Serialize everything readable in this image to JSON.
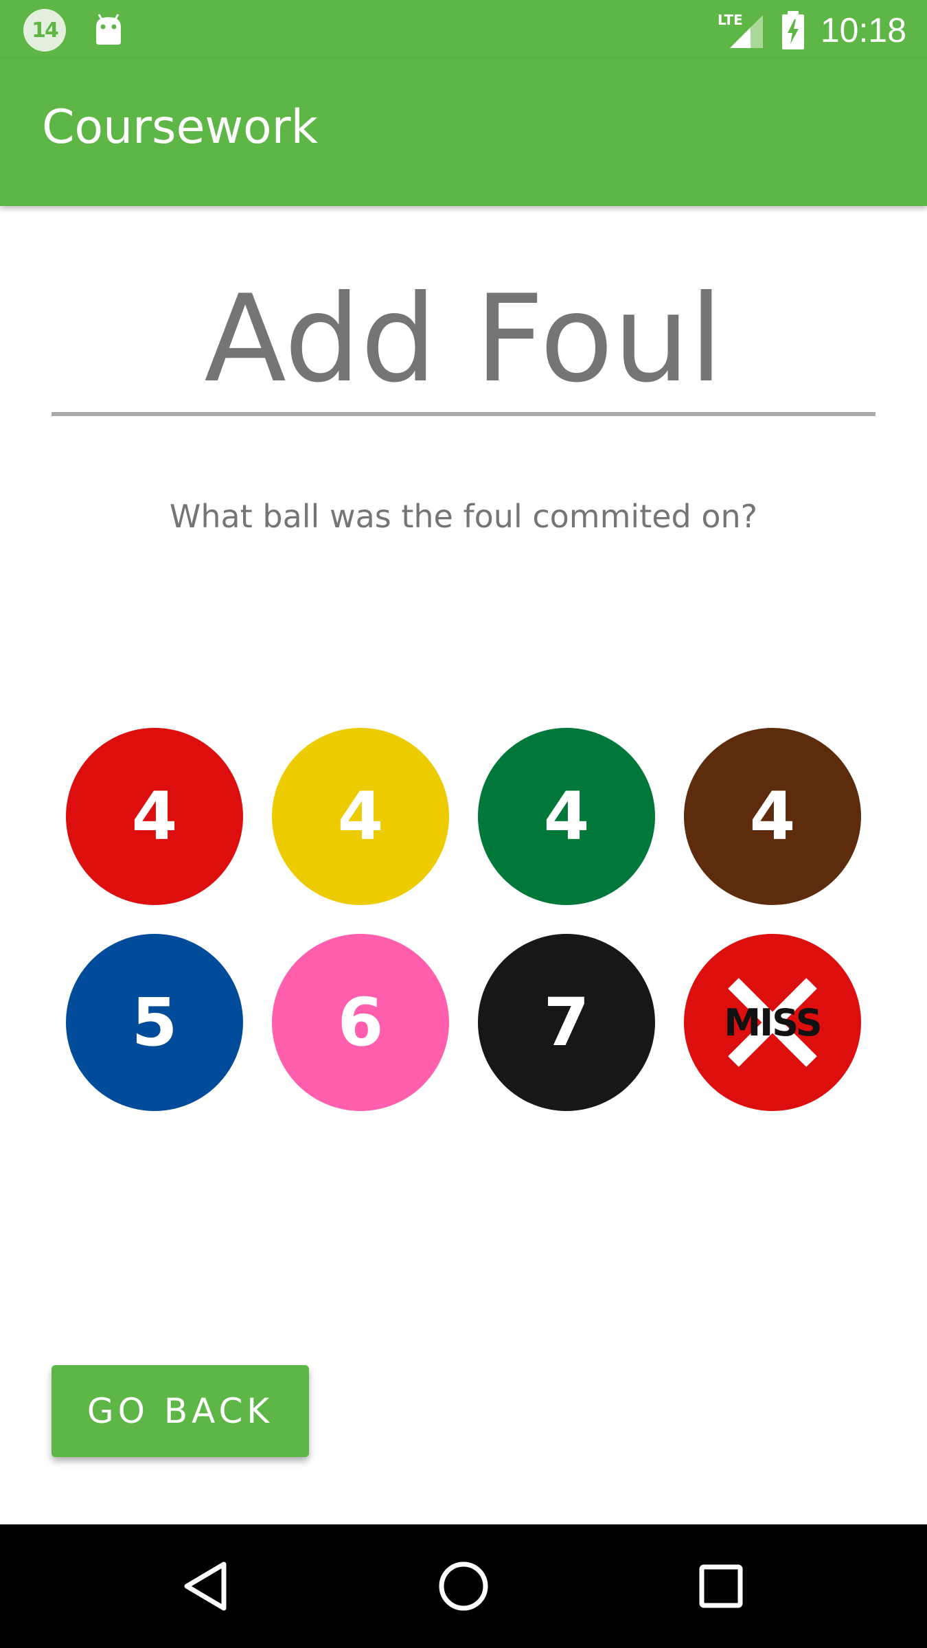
{
  "status_bar": {
    "notification_badge": "14",
    "time": "10:18",
    "icons": [
      "notification-badge",
      "android-icon",
      "lte-signal-icon",
      "battery-charging-icon"
    ]
  },
  "app_bar": {
    "title": "Coursework"
  },
  "main": {
    "heading": "Add Foul",
    "question": "What ball was the foul commited on?",
    "balls": [
      {
        "label": "4",
        "color": "#dc0e0e"
      },
      {
        "label": "4",
        "color": "#eccc00"
      },
      {
        "label": "4",
        "color": "#00783a"
      },
      {
        "label": "4",
        "color": "#5c2c0c"
      },
      {
        "label": "5",
        "color": "#004b9a"
      },
      {
        "label": "6",
        "color": "#ff5fac"
      },
      {
        "label": "7",
        "color": "#171717"
      },
      {
        "label": "MISS",
        "color": "#dc0e0e"
      }
    ],
    "go_back_label": "GO BACK"
  },
  "colors": {
    "accent": "#5db645",
    "heading_text": "#757575"
  },
  "nav_bar": {
    "buttons": [
      "back-icon",
      "home-icon",
      "recents-icon"
    ]
  }
}
